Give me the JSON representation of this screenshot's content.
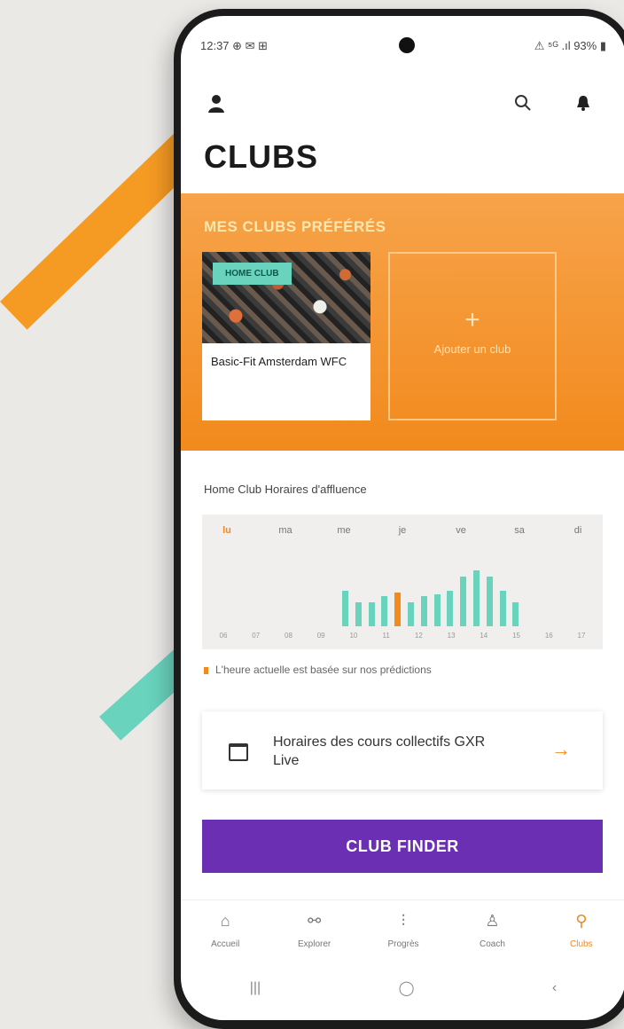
{
  "status_bar": {
    "time": "12:37 ⊕ ✉ ⊞",
    "system": "⚠ ⁵ᴳ .ıl 93% ▮"
  },
  "header": {
    "profile_icon": "person-icon",
    "search_icon": "search-icon",
    "notification_icon": "bell-icon",
    "title": "CLUBS"
  },
  "favorites": {
    "title": "MES CLUBS PRÉFÉRÉS",
    "club": {
      "badge": "HOME CLUB",
      "name": "Basic-Fit Amsterdam WFC"
    },
    "add_icon": "+",
    "add_label": "Ajouter un club"
  },
  "attendance": {
    "title": "Home Club Horaires d'affluence",
    "days": [
      "lu",
      "ma",
      "me",
      "je",
      "ve",
      "sa",
      "di"
    ],
    "active_day": "lu",
    "hours": [
      "06",
      "07",
      "08",
      "09",
      "10",
      "11",
      "12",
      "13",
      "14",
      "15",
      "16",
      "17"
    ],
    "bar_levels": [
      0.45,
      0.3,
      0.3,
      0.38,
      0.42,
      0.3,
      0.38,
      0.4,
      0.45,
      0.62,
      0.7,
      0.62,
      0.45,
      0.3
    ],
    "current_bar_index": 4,
    "note": "L'heure actuelle est basée sur nos prédictions"
  },
  "schedule": {
    "icon": "calendar-icon",
    "text": "Horaires des cours collectifs GXR Live",
    "arrow_icon": "arrow-right-icon"
  },
  "club_finder": {
    "label": "CLUB FINDER"
  },
  "bottom_nav": [
    {
      "label": "Accueil",
      "icon": "home-icon",
      "glyph": "⌂"
    },
    {
      "label": "Explorer",
      "icon": "dumbbell-icon",
      "glyph": "⚯"
    },
    {
      "label": "Progrès",
      "icon": "progress-icon",
      "glyph": "⫶"
    },
    {
      "label": "Coach",
      "icon": "coach-icon",
      "glyph": "♙"
    },
    {
      "label": "Clubs",
      "icon": "location-pin-icon",
      "glyph": "⚲"
    }
  ],
  "active_nav": "Clubs",
  "system_nav": {
    "recent": "|||",
    "home": "◯",
    "back": "‹"
  },
  "colors": {
    "accent_orange": "#f28a1d",
    "teal": "#69d3bd",
    "purple": "#6a2fb2"
  }
}
